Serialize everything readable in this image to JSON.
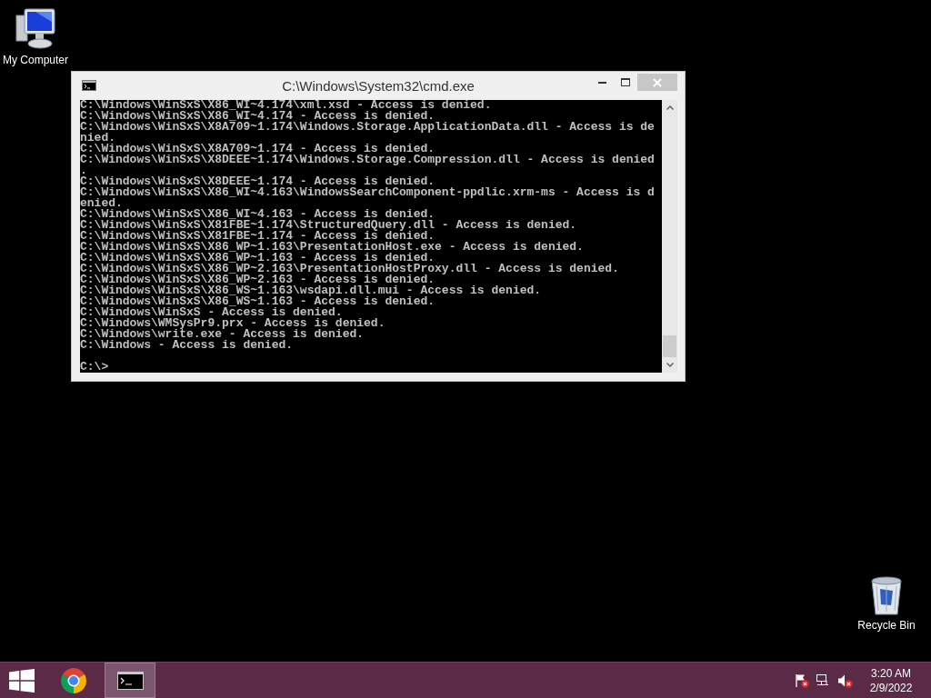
{
  "desktop_icons": [
    {
      "kind": "computer",
      "label": "My Computer"
    },
    {
      "kind": "recycle-bin",
      "label": "Recycle Bin"
    }
  ],
  "window": {
    "title": "C:\\Windows\\System32\\cmd.exe",
    "console": {
      "lines": [
        "C:\\Windows\\WinSxS\\X86_WI~4.174\\xml.xsd - Access is denied.",
        "C:\\Windows\\WinSxS\\X86_WI~4.174 - Access is denied.",
        "C:\\Windows\\WinSxS\\X8A709~1.174\\Windows.Storage.ApplicationData.dll - Access is de",
        "nied.",
        "C:\\Windows\\WinSxS\\X8A709~1.174 - Access is denied.",
        "C:\\Windows\\WinSxS\\X8DEEE~1.174\\Windows.Storage.Compression.dll - Access is denied",
        ".",
        "C:\\Windows\\WinSxS\\X8DEEE~1.174 - Access is denied.",
        "C:\\Windows\\WinSxS\\X86_WI~4.163\\WindowsSearchComponent-ppdlic.xrm-ms - Access is d",
        "enied.",
        "C:\\Windows\\WinSxS\\X86_WI~4.163 - Access is denied.",
        "C:\\Windows\\WinSxS\\X81FBE~1.174\\StructuredQuery.dll - Access is denied.",
        "C:\\Windows\\WinSxS\\X81FBE~1.174 - Access is denied.",
        "C:\\Windows\\WinSxS\\X86_WP~1.163\\PresentationHost.exe - Access is denied.",
        "C:\\Windows\\WinSxS\\X86_WP~1.163 - Access is denied.",
        "C:\\Windows\\WinSxS\\X86_WP~2.163\\PresentationHostProxy.dll - Access is denied.",
        "C:\\Windows\\WinSxS\\X86_WP~2.163 - Access is denied.",
        "C:\\Windows\\WinSxS\\X86_WS~1.163\\wsdapi.dll.mui - Access is denied.",
        "C:\\Windows\\WinSxS\\X86_WS~1.163 - Access is denied.",
        "C:\\Windows\\WinSxS - Access is denied.",
        "C:\\Windows\\WMSysPr9.prx - Access is denied.",
        "C:\\Windows\\write.exe - Access is denied.",
        "C:\\Windows - Access is denied."
      ],
      "prompt": "C:\\>"
    }
  },
  "taskbar": {
    "apps": [
      {
        "kind": "browser",
        "selected": false
      },
      {
        "kind": "console",
        "selected": true
      }
    ],
    "tray": [
      {
        "kind": "flag",
        "alert": true
      },
      {
        "kind": "network",
        "alert": false
      },
      {
        "kind": "speaker",
        "alert": true
      }
    ],
    "clock": {
      "time": "3:20 AM",
      "date": "2/9/2022"
    }
  }
}
